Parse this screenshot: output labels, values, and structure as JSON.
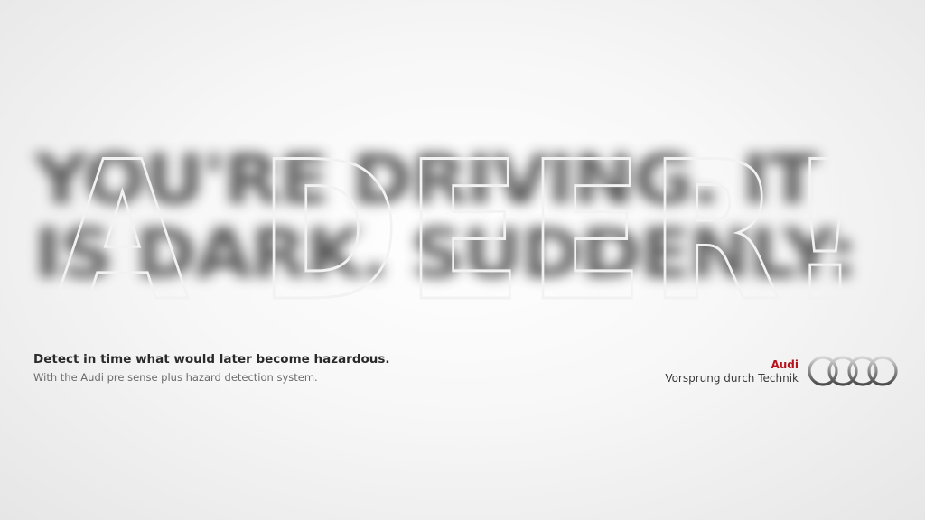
{
  "headline": {
    "blurred_lines": [
      "YOU'RE DRIVING. IT",
      "IS DARK. SUDDENLY:"
    ],
    "overlay": "A DEER!"
  },
  "copy": {
    "tagline": "Detect in time what would later become hazardous.",
    "subline": "With the Audi pre sense plus hazard detection system."
  },
  "brand": {
    "name": "Audi",
    "slogan": "Vorsprung durch Technik",
    "logo": "audi-four-rings-logo",
    "accent_color": "#b5121b"
  }
}
